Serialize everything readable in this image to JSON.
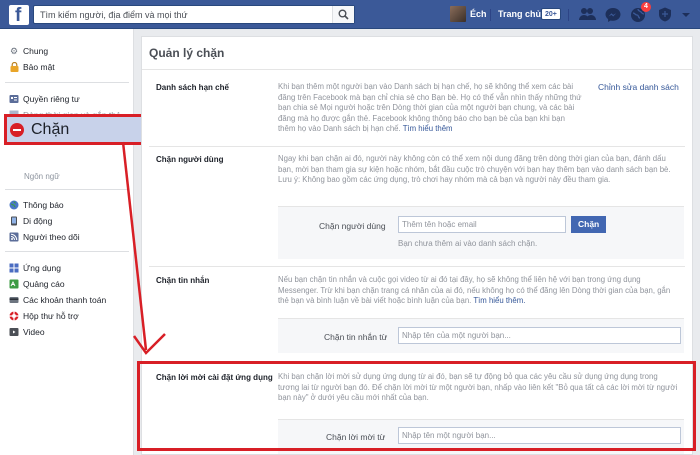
{
  "topbar": {
    "logo": "f",
    "search_placeholder": "Tìm kiếm người, địa điểm và mọi thứ",
    "user_name": "Éch",
    "home_label": "Trang chủ",
    "home_badge": "20+",
    "notifications_count": "4"
  },
  "sidebar": {
    "items": [
      {
        "label": "Chung",
        "icon": "gear-icon"
      },
      {
        "label": "Bảo mật",
        "icon": "lock-icon"
      },
      {
        "label": "Quyền riêng tư",
        "icon": "privacy-icon"
      },
      {
        "label": "Dòng thời gian và gắn thẻ",
        "icon": "timeline-icon"
      },
      {
        "label": "Chặn",
        "icon": "block-icon"
      },
      {
        "label": "Ngôn ngữ",
        "icon": "language-icon"
      },
      {
        "label": "Thông báo",
        "icon": "globe-icon"
      },
      {
        "label": "Di động",
        "icon": "mobile-icon"
      },
      {
        "label": "Người theo dõi",
        "icon": "rss-icon"
      },
      {
        "label": "Ứng dụng",
        "icon": "apps-icon"
      },
      {
        "label": "Quảng cáo",
        "icon": "ads-icon"
      },
      {
        "label": "Các khoản thanh toán",
        "icon": "payments-icon"
      },
      {
        "label": "Hộp thư hỗ trợ",
        "icon": "support-icon"
      },
      {
        "label": "Video",
        "icon": "video-icon"
      }
    ]
  },
  "main": {
    "title": "Quản lý chặn",
    "restricted": {
      "label": "Danh sách hạn chế",
      "desc": "Khi bạn thêm một người bạn vào Danh sách bị hạn chế, họ sẽ không thể xem các bài đăng trên Facebook mà bạn chỉ chia sẻ cho Bạn bè. Họ có thể vẫn nhìn thấy những thứ bạn chia sẻ Mọi người hoặc trên Dòng thời gian của một người bạn chung, và các bài đăng mà họ được gắn thẻ. Facebook không thông báo cho bạn bè của bạn khi bạn thêm họ vào Danh sách bị hạn chế.",
      "learn_more": "Tìm hiểu thêm",
      "edit_link": "Chỉnh sửa danh sách"
    },
    "block_users": {
      "label": "Chặn người dùng",
      "desc": "Ngay khi bạn chặn ai đó, người này không còn có thể xem nội dung đăng trên dòng thời gian của bạn, đánh dấu bạn, mời bạn tham gia sự kiện hoặc nhóm, bắt đầu cuộc trò chuyện với bạn hay thêm bạn vào danh sách bạn bè. Lưu ý: Không bao gồm các ứng dụng, trò chơi hay nhóm mà cả bạn và người này đều tham gia.",
      "form_label": "Chặn người dùng",
      "placeholder": "Thêm tên hoặc email",
      "button": "Chặn",
      "hint": "Bạn chưa thêm ai vào danh sách chặn."
    },
    "block_messages": {
      "label": "Chặn tin nhắn",
      "desc": "Nếu bạn chặn tin nhắn và cuộc gọi video từ ai đó tại đây, họ sẽ không thể liên hệ với bạn trong ứng dụng Messenger. Trừ khi bạn chặn trang cá nhân của ai đó, nếu không họ có thể đăng lên Dòng thời gian của bạn, gắn thẻ bạn và bình luận về bài viết hoặc bình luận của bạn.",
      "learn_more": "Tìm hiểu thêm.",
      "form_label": "Chặn tin nhắn từ",
      "placeholder": "Nhập tên của một người bạn..."
    },
    "block_app_invites": {
      "label": "Chặn lời mời cài đặt ứng dụng",
      "desc": "Khi bạn chặn lời mời sử dụng ứng dụng từ ai đó, bạn sẽ tự động bỏ qua các yêu cầu sử dụng ứng dụng trong tương lai từ người bạn đó. Để chặn lời mời từ một người bạn, nhấp vào liên kết \"Bỏ qua tất cả các lời mời từ người bạn này\" ở dưới yêu cầu mới nhất của bạn.",
      "form_label": "Chặn lời mời từ",
      "placeholder": "Nhập tên một người bạn..."
    }
  },
  "colors": {
    "brand": "#3b5998",
    "annotation": "#d81f26",
    "link": "#365899"
  }
}
